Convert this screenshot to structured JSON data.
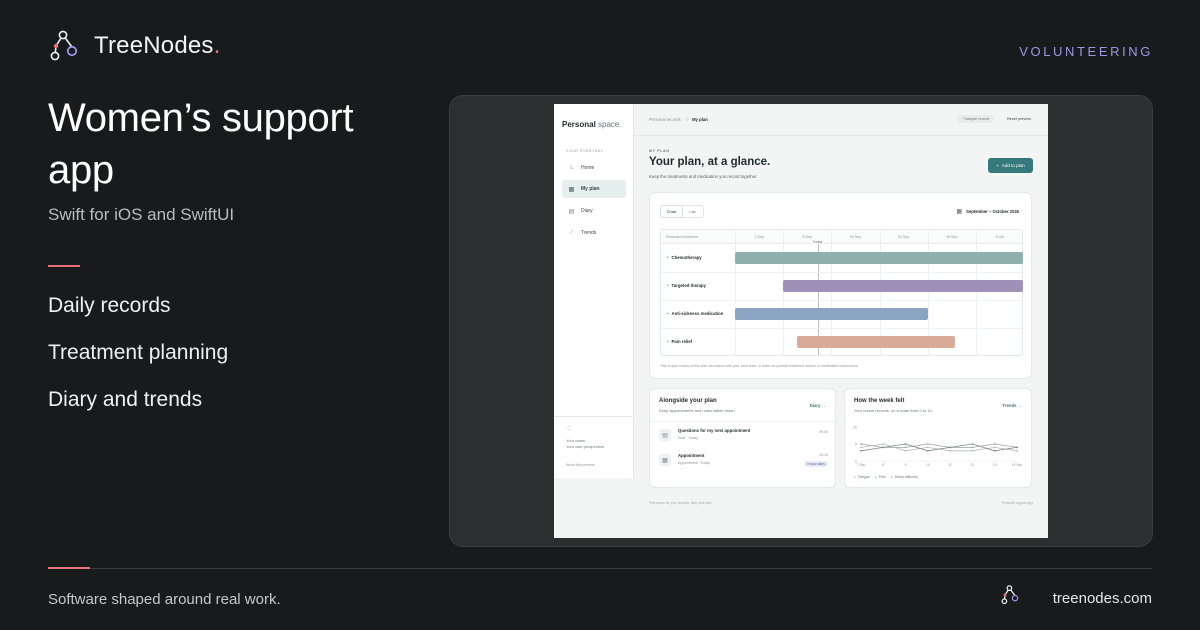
{
  "brand": {
    "name": "TreeNodes",
    "dot": ".",
    "logo_icon": "tree-nodes-icon"
  },
  "category": "VOLUNTEERING",
  "title": "Women’s support app",
  "subtitle": "Swift for iOS and SwiftUI",
  "features": [
    "Daily records",
    "Treatment planning",
    "Diary and trends"
  ],
  "footer": {
    "tagline": "Software shaped around real work.",
    "domain": "treenodes.com"
  },
  "colors": {
    "accent": "#e8707a",
    "category": "#9d96e6",
    "app_primary": "#36797a"
  },
  "app": {
    "logo": {
      "main": "Personal",
      "rest": " space",
      "dot": "."
    },
    "section_label": "YOUR EVERYDAY",
    "nav": [
      {
        "label": "Home",
        "icon": "home-icon"
      },
      {
        "label": "My plan",
        "icon": "calendar-icon"
      },
      {
        "label": "Diary",
        "icon": "diary-icon"
      },
      {
        "label": "Trends",
        "icon": "trend-icon"
      }
    ],
    "side_note_1": "Your notes.",
    "side_note_2": "Your own perspective.",
    "side_link": "About this preview",
    "breadcrumb": {
      "root": "Personal records",
      "sep": "/",
      "current": "My plan"
    },
    "sample_chip": "Sample record",
    "reset": "Reset preview",
    "eyebrow": "MY PLAN",
    "heading": "Your plan, at a glance.",
    "lede": "Keep the treatments and medication you record together.",
    "add_button": "Add to plan",
    "gantt": {
      "tabs": [
        "Chart",
        "List"
      ],
      "range": "September – October 2026",
      "header_label": "Recorded treatment",
      "today": "Today",
      "note": "This is your record of the plan discussed with your care team. It does not provide treatment advice or medication instructions."
    },
    "alongside": {
      "title": "Alongside your plan",
      "sub": "Keep appointments and notes within reach.",
      "link": "Diary →",
      "items": [
        {
          "title": "Questions for my next appointment",
          "meta": "Note · Today",
          "time": "09:40",
          "icon": "note-icon"
        },
        {
          "title": "Appointment",
          "meta": "Appointment · Today",
          "time": "15:10",
          "pill": "In your diary",
          "icon": "calendar-icon"
        }
      ]
    },
    "week": {
      "title": "How the week felt",
      "sub": "Your recent records, on a scale from 0 to 10.",
      "link": "Trends →",
      "legend": [
        "Fatigue",
        "Pain",
        "Sleep difficulty"
      ]
    },
    "bottom_note": "This space for your records, diary and plan.",
    "bottom_note_right": "Personal support app"
  },
  "chart_data": [
    {
      "type": "gantt",
      "x_ticks": [
        "1 Sep",
        "8 Sep",
        "15 Sep",
        "22 Sep",
        "29 Sep",
        "6 Oct"
      ],
      "today": "13 Sep",
      "tasks": [
        {
          "name": "Chemotherapy",
          "start": "1 Sep",
          "end": "19 Oct",
          "color": "#8fb0ad"
        },
        {
          "name": "Targeted therapy",
          "start": "8 Sep",
          "end": "13 Oct",
          "color": "#9f90b8"
        },
        {
          "name": "Anti-sickness medication",
          "start": "1 Sep",
          "end": "29 Sep",
          "color": "#8ba4c2"
        },
        {
          "name": "Pain relief",
          "start": "10 Sep",
          "end": "3 Oct",
          "color": "#d8ab98"
        }
      ]
    },
    {
      "type": "line",
      "x": [
        "7 Sep",
        "8",
        "9",
        "10",
        "11",
        "12",
        "13",
        "14 Sep"
      ],
      "ylim": [
        0,
        10
      ],
      "y_ticks": [
        "10",
        "5",
        "0"
      ],
      "series": [
        {
          "name": "Fatigue",
          "values": [
            5,
            4,
            4,
            5,
            4,
            4,
            5,
            4
          ]
        },
        {
          "name": "Pain",
          "values": [
            4,
            5,
            3,
            4,
            3,
            3,
            4,
            3
          ]
        },
        {
          "name": "Sleep difficulty",
          "values": [
            3,
            4,
            5,
            3,
            4,
            5,
            3,
            4
          ]
        }
      ]
    }
  ]
}
